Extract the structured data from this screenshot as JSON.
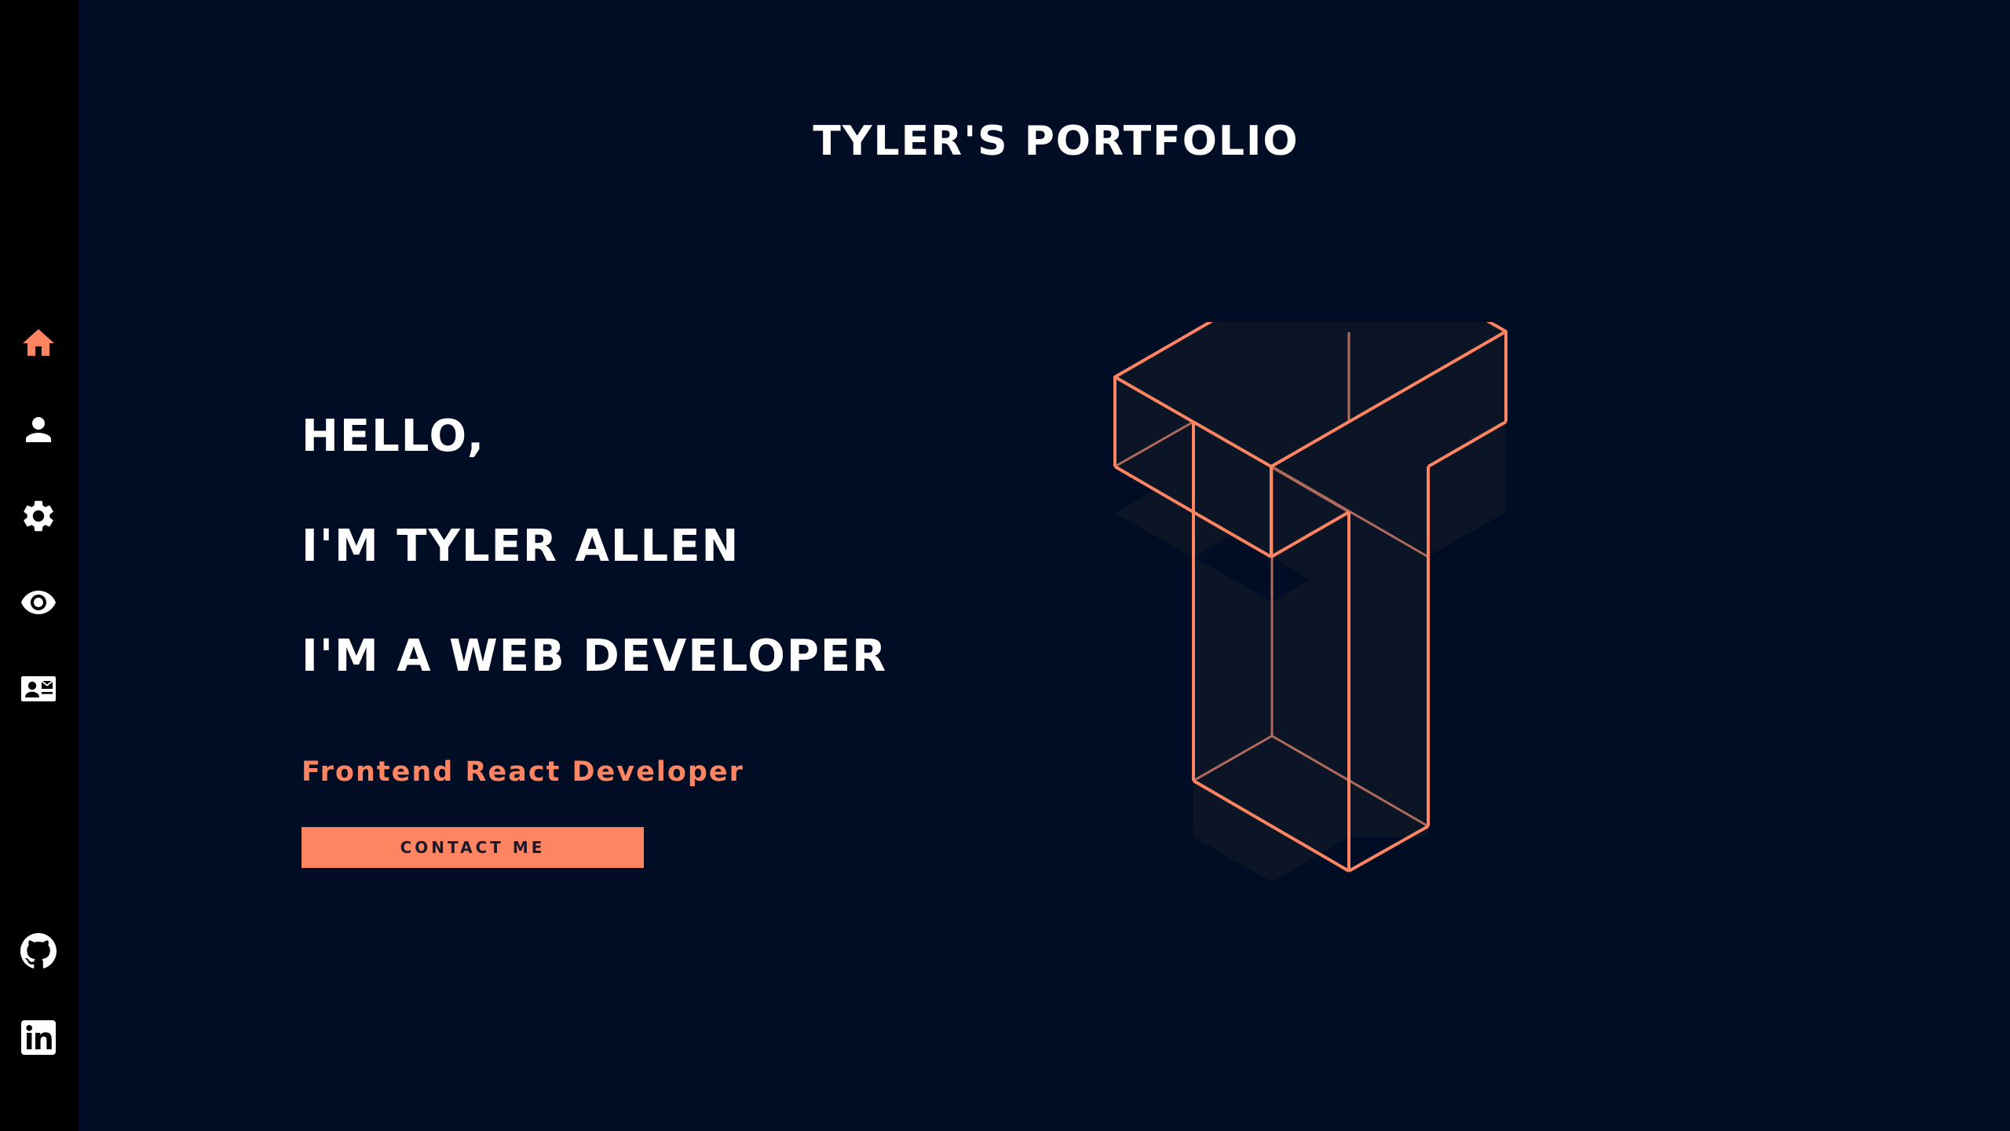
{
  "sidebar": {
    "nav": [
      {
        "name": "home",
        "icon": "home-icon",
        "active": true
      },
      {
        "name": "about",
        "icon": "person-icon"
      },
      {
        "name": "skills",
        "icon": "gear-icon"
      },
      {
        "name": "portfolio",
        "icon": "eye-icon"
      },
      {
        "name": "contact",
        "icon": "contact-card-icon"
      }
    ],
    "social": [
      {
        "name": "github",
        "icon": "github-icon"
      },
      {
        "name": "linkedin",
        "icon": "linkedin-icon"
      }
    ]
  },
  "header": {
    "title": "TYLER'S PORTFOLIO"
  },
  "hero": {
    "line1": "HELLO,",
    "line2": "I'M TYLER ALLEN",
    "line3": "I'M A WEB DEVELOPER",
    "subtitle": "Frontend React Developer",
    "cta_label": "CONTACT ME"
  },
  "colors": {
    "background": "#000d24",
    "sidebar": "#000000",
    "accent": "#ff8562",
    "text": "#ffffff"
  }
}
